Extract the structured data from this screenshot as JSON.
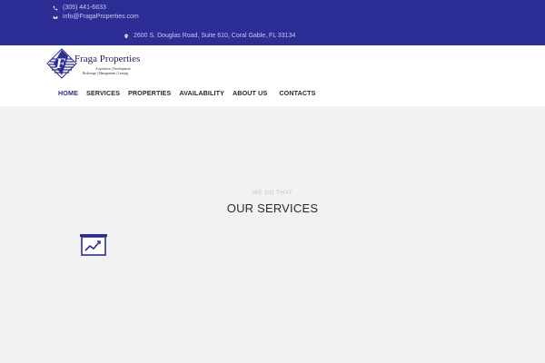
{
  "topbar": {
    "phone": "(305) 441-6633",
    "email": "info@FragaProperties.com",
    "address": "2600 S. Douglas Road, Suite 610, Coral Gable, FL 33134"
  },
  "logo": {
    "letter": "F",
    "name": "Fraga Properties",
    "tagline_1": "Acquisition | Development",
    "tagline_2": "Brokerage | Management | Leasing"
  },
  "nav": {
    "items": [
      {
        "label": "HOME",
        "active": true
      },
      {
        "label": "SERVICES"
      },
      {
        "label": "PROPERTIES"
      },
      {
        "label": "AVAILABILITY"
      },
      {
        "label": "ABOUT US"
      },
      {
        "label": "CONTACTS"
      }
    ]
  },
  "services": {
    "eyebrow": "WE DO THAT",
    "heading": "OUR SERVICES",
    "icon": "presentation-chart-icon"
  },
  "colors": {
    "brand": "#2d2d96",
    "hero_bg": "#f2f2f2"
  }
}
